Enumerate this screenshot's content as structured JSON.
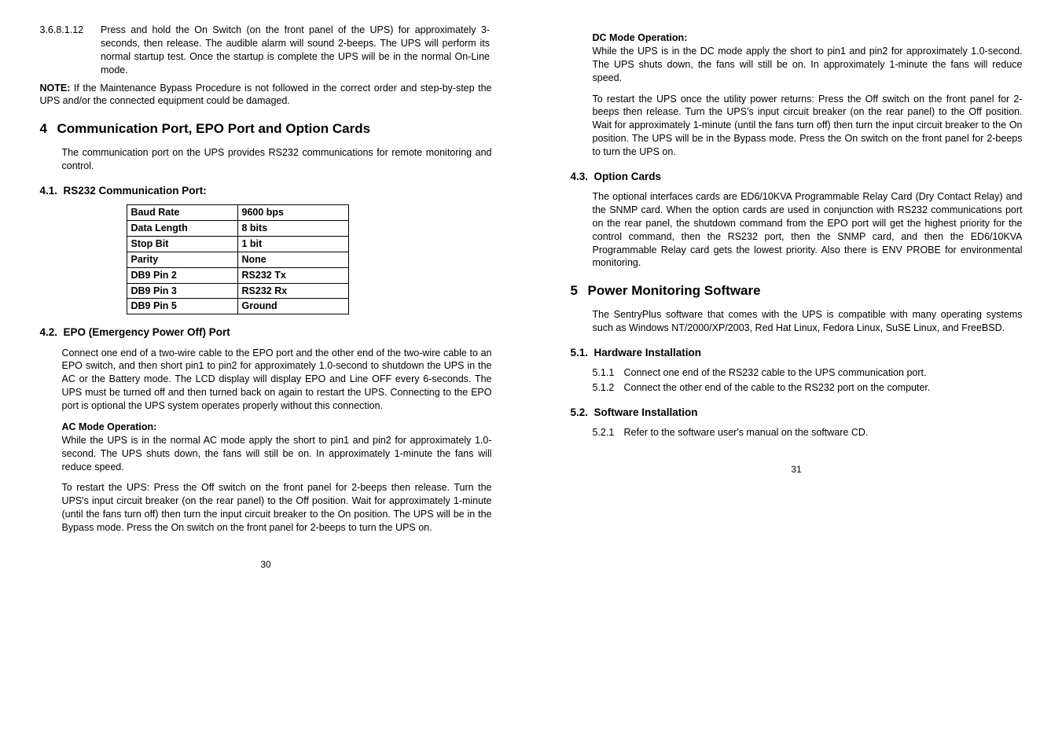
{
  "left": {
    "item_num": "3.6.8.1.12",
    "item_txt": "Press and hold the On Switch (on the front panel of the UPS) for approximately 3-seconds, then release. The audible alarm will sound 2-beeps. The UPS will perform its normal startup test. Once the startup is complete the UPS will be in the normal On-Line mode.",
    "note_label": "NOTE:",
    "note_txt": " If the Maintenance Bypass Procedure is not followed in the correct order and step-by-step the UPS and/or the connected equipment could be damaged.",
    "sec4_num": "4",
    "sec4_title": "Communication Port, EPO Port and Option Cards",
    "sec4_body": "The communication port on the UPS provides RS232 communications for remote monitoring and control.",
    "sub41_num": "4.1.",
    "sub41_title": "RS232 Communication Port:",
    "table": [
      [
        "Baud Rate",
        "9600 bps"
      ],
      [
        "Data Length",
        "8 bits"
      ],
      [
        "Stop Bit",
        "1 bit"
      ],
      [
        "Parity",
        "None"
      ],
      [
        "DB9 Pin 2",
        "RS232 Tx"
      ],
      [
        "DB9 Pin 3",
        "RS232 Rx"
      ],
      [
        "DB9 Pin 5",
        "Ground"
      ]
    ],
    "sub42_num": "4.2.",
    "sub42_title": "EPO (Emergency Power Off) Port",
    "sub42_body": "Connect one end of a two-wire cable to the EPO port and the other end of the two-wire cable to an EPO switch, and then short pin1 to pin2 for approximately 1.0-second to shutdown the UPS in the AC or the Battery mode. The LCD display will display EPO and Line OFF every 6-seconds. The UPS must be turned off and then turned back on again to restart the UPS. Connecting to the EPO port is optional the UPS system operates properly without this connection.",
    "ac_head": "AC Mode Operation:",
    "ac_body1": "While the UPS is in the normal AC mode apply the short to pin1 and pin2 for approximately 1.0-second. The UPS shuts down, the fans will still be on. In approximately 1-minute the fans will reduce speed.",
    "ac_body2": "To restart the UPS: Press the Off switch on the front panel for 2-beeps then release. Turn the UPS's input circuit breaker (on the rear panel) to the Off position. Wait for approximately 1-minute (until the fans turn off) then turn the input circuit breaker to the On position. The UPS will be in the Bypass mode. Press the On switch on the front panel for 2-beeps to turn the UPS on.",
    "pagenum": "30"
  },
  "right": {
    "dc_head": "DC Mode Operation:",
    "dc_body1": "While the UPS is in the DC mode apply the short to pin1 and pin2 for approximately 1.0-second. The UPS shuts down, the fans will still be on. In approximately 1-minute the fans will reduce speed.",
    "dc_body2": "To restart the UPS once the utility power returns: Press the Off switch on the front panel for 2-beeps then release. Turn the UPS's input circuit breaker (on the rear panel) to the Off position. Wait for approximately 1-minute (until the fans turn off) then turn the input circuit breaker to the On position. The UPS will be in the Bypass mode. Press the On switch on the front panel for 2-beeps to turn the UPS on.",
    "sub43_num": "4.3.",
    "sub43_title": "Option Cards",
    "sub43_body": "The optional interfaces cards are ED6/10KVA Programmable Relay Card (Dry Contact Relay) and the SNMP card. When the option cards are used in conjunction with RS232 communications port on the rear panel, the shutdown command from the EPO port will get the highest priority for the control command, then the RS232 port, then the SNMP card, and then the ED6/10KVA Programmable Relay card gets the lowest priority. Also there is ENV PROBE for environmental monitoring.",
    "sec5_num": "5",
    "sec5_title": "Power Monitoring Software",
    "sec5_body": "The SentryPlus software that comes with the UPS is compatible with many operating systems such as Windows NT/2000/XP/2003, Red Hat Linux, Fedora Linux, SuSE Linux, and FreeBSD.",
    "sub51_num": "5.1.",
    "sub51_title": "Hardware Installation",
    "li511_num": "5.1.1",
    "li511_txt": "Connect one end of the RS232 cable to the UPS communication port.",
    "li512_num": "5.1.2",
    "li512_txt": "Connect the other end of the cable to the RS232 port on the computer.",
    "sub52_num": "5.2.",
    "sub52_title": "Software Installation",
    "li521_num": "5.2.1",
    "li521_txt": "Refer to the software user's manual on the software CD.",
    "pagenum": "31"
  }
}
